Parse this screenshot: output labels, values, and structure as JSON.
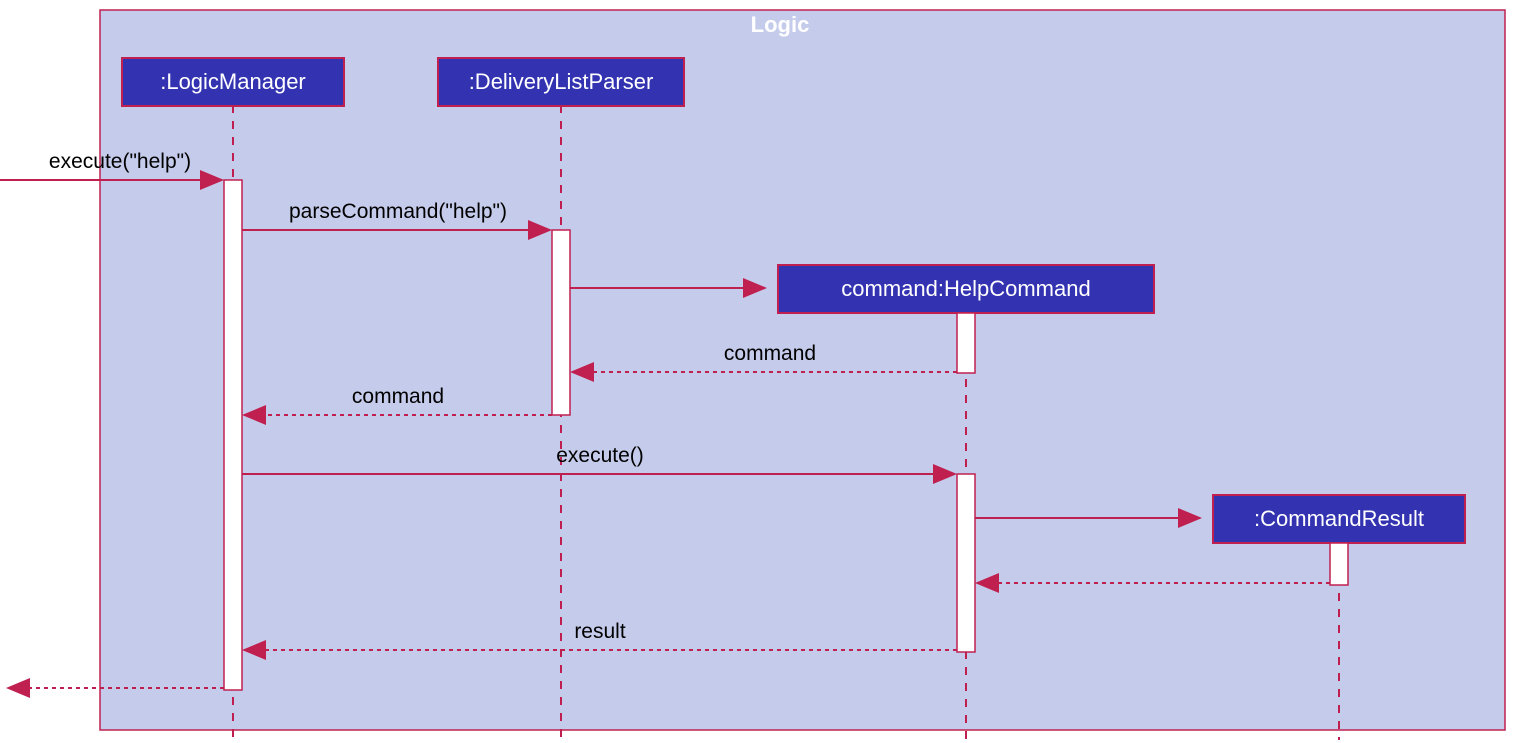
{
  "frame": {
    "title": "Logic"
  },
  "participants": {
    "logicManager": ":LogicManager",
    "deliveryListParser": ":DeliveryListParser",
    "helpCommand": "command:HelpCommand",
    "commandResult": ":CommandResult"
  },
  "messages": {
    "execute_help": "execute(\"help\")",
    "parseCommand": "parseCommand(\"help\")",
    "command1": "command",
    "command2": "command",
    "execute": "execute()",
    "result": "result"
  },
  "chart_data": {
    "type": "sequence-diagram",
    "frame": "Logic",
    "participants": [
      {
        "id": "LogicManager",
        "label": ":LogicManager",
        "created_at_start": true
      },
      {
        "id": "DeliveryListParser",
        "label": ":DeliveryListParser",
        "created_at_start": true
      },
      {
        "id": "HelpCommand",
        "label": "command:HelpCommand",
        "created_at_start": false
      },
      {
        "id": "CommandResult",
        "label": ":CommandResult",
        "created_at_start": false
      }
    ],
    "messages": [
      {
        "from": "external",
        "to": "LogicManager",
        "label": "execute(\"help\")",
        "type": "sync"
      },
      {
        "from": "LogicManager",
        "to": "DeliveryListParser",
        "label": "parseCommand(\"help\")",
        "type": "sync"
      },
      {
        "from": "DeliveryListParser",
        "to": "HelpCommand",
        "label": "",
        "type": "create"
      },
      {
        "from": "HelpCommand",
        "to": "DeliveryListParser",
        "label": "command",
        "type": "return"
      },
      {
        "from": "DeliveryListParser",
        "to": "LogicManager",
        "label": "command",
        "type": "return"
      },
      {
        "from": "LogicManager",
        "to": "HelpCommand",
        "label": "execute()",
        "type": "sync"
      },
      {
        "from": "HelpCommand",
        "to": "CommandResult",
        "label": "",
        "type": "create"
      },
      {
        "from": "CommandResult",
        "to": "HelpCommand",
        "label": "",
        "type": "return"
      },
      {
        "from": "HelpCommand",
        "to": "LogicManager",
        "label": "result",
        "type": "return"
      },
      {
        "from": "LogicManager",
        "to": "external",
        "label": "",
        "type": "return"
      }
    ]
  }
}
